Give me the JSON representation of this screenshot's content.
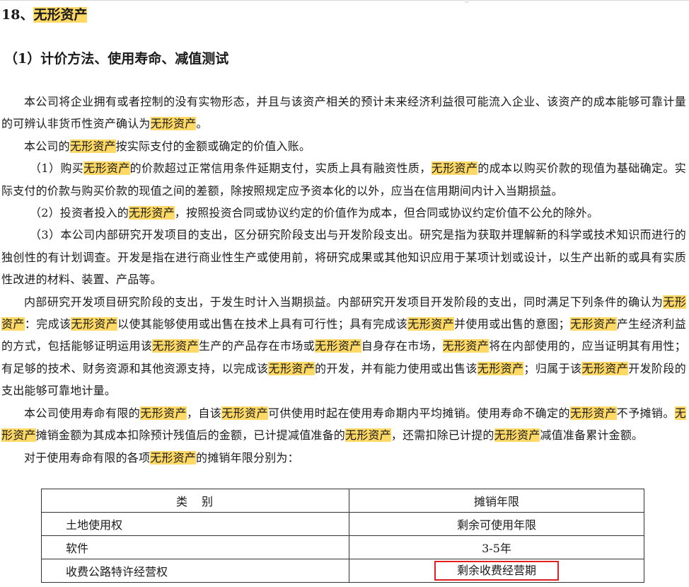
{
  "heading": {
    "number": "18、",
    "title": "无形资产"
  },
  "subheading": "（1）计价方法、使用寿命、减值测试",
  "paragraphs": {
    "p1": {
      "a": "本公司将企业拥有或者控制的没有实物形态，并且与该资产相关的预计未来经济利益很可能流入企业、该资产的成本能够可靠计量的可辨认非货币性资产确认为",
      "b": "。"
    },
    "p2": {
      "a": "本公司的",
      "b": "按实际支付的金额或确定的价值入账。"
    },
    "p3": {
      "a": "（1）购买",
      "b": "的价款超过正常信用条件延期支付，实质上具有融资性质，",
      "c": "的成本以购买价款的现值为基础确定。实际支付的价款与购买价款的现值之间的差额，除按照规定应予资本化的以外，应当在信用期间内计入当期损益。"
    },
    "p4": {
      "a": "（2）投资者投入的",
      "b": "，按照投资合同或协议约定的价值作为成本，但合同或协议约定价值不公允的除外。"
    },
    "p5": "（3）本公司内部研究开发项目的支出，区分研究阶段支出与开发阶段支出。研究是指为获取并理解新的科学或技术知识而进行的独创性的有计划调查。开发是指在进行商业性生产或使用前，将研究成果或其他知识应用于某项计划或设计，以生产出新的或具有实质性改进的材料、装置、产品等。",
    "p6": {
      "a": "内部研究开发项目研究阶段的支出，于发生时计入当期损益。内部研究开发项目开发阶段的支出，同时满足下列条件的确认为",
      "b": "：完成该",
      "c": "以使其能够使用或出售在技术上具有可行性；具有完成该",
      "d": "并使用或出售的意图；",
      "e": "产生经济利益的方式，包括能够证明运用该",
      "f": "生产的产品存在市场或",
      "g": "自身存在市场，",
      "h": "将在内部使用的，应当证明其有用性；有足够的技术、财务资源和其他资源支持，以完成该",
      "i": "的开发，并有能力使用或出售该",
      "j": "；归属于该",
      "k": "开发阶段的支出能够可靠地计量。"
    },
    "p7": {
      "a": "本公司使用寿命有限的",
      "b": "，自该",
      "c": "可供使用时起在使用寿命期内平均摊销。使用寿命不确定的",
      "d": "不予摊销。",
      "e": "摊销金额为其成本扣除预计残值后的金额，已计提减值准备的",
      "f": "，还需扣除已计提的",
      "g": "减值准备累计金额。"
    },
    "p8": {
      "a": "对于使用寿命有限的各项",
      "b": "的摊销年限分别为："
    }
  },
  "table": {
    "headers": [
      "类　别",
      "摊销年限"
    ],
    "rows": [
      [
        "土地使用权",
        "剩余可使用年限"
      ],
      [
        "软件",
        "3-5年"
      ],
      [
        "收费公路特许经营权",
        "剩余收费经营期"
      ]
    ]
  },
  "colors": {
    "highlight": "#ffd966",
    "annotation_box": "#e02020"
  }
}
